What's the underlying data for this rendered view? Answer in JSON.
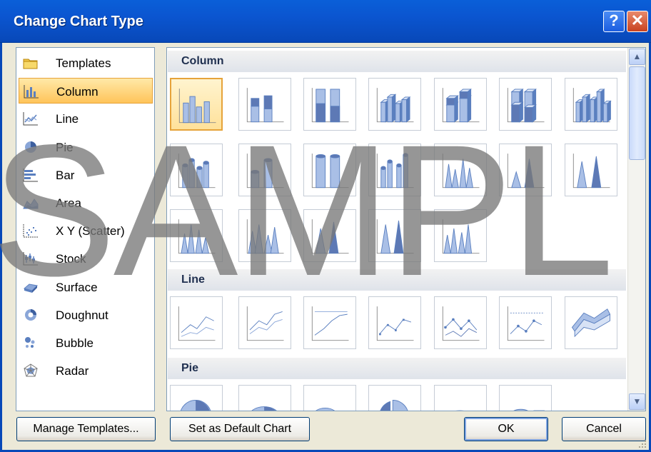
{
  "window": {
    "title": "Change Chart Type",
    "help_label": "?",
    "close_label": "✕"
  },
  "categories": [
    {
      "label": "Templates",
      "icon": "folder-icon"
    },
    {
      "label": "Column",
      "icon": "column-chart-icon",
      "selected": true
    },
    {
      "label": "Line",
      "icon": "line-chart-icon"
    },
    {
      "label": "Pie",
      "icon": "pie-chart-icon"
    },
    {
      "label": "Bar",
      "icon": "bar-chart-icon"
    },
    {
      "label": "Area",
      "icon": "area-chart-icon"
    },
    {
      "label": "X Y (Scatter)",
      "icon": "scatter-chart-icon"
    },
    {
      "label": "Stock",
      "icon": "stock-chart-icon"
    },
    {
      "label": "Surface",
      "icon": "surface-chart-icon"
    },
    {
      "label": "Doughnut",
      "icon": "doughnut-chart-icon"
    },
    {
      "label": "Bubble",
      "icon": "bubble-chart-icon"
    },
    {
      "label": "Radar",
      "icon": "radar-chart-icon"
    }
  ],
  "gallery": {
    "sections": [
      {
        "heading": "Column",
        "tile_count": 19
      },
      {
        "heading": "Line",
        "tile_count": 7
      },
      {
        "heading": "Pie",
        "tile_count": 6
      }
    ],
    "selected": "Clustered Column"
  },
  "buttons": {
    "manage_templates": "Manage Templates...",
    "set_default": "Set as Default Chart",
    "ok": "OK",
    "cancel": "Cancel"
  },
  "watermark": "SAMPL",
  "colors": {
    "titlebar": "#0b55d0",
    "selection": "#ffc45a",
    "chart_blue": "#5a7fbf"
  }
}
